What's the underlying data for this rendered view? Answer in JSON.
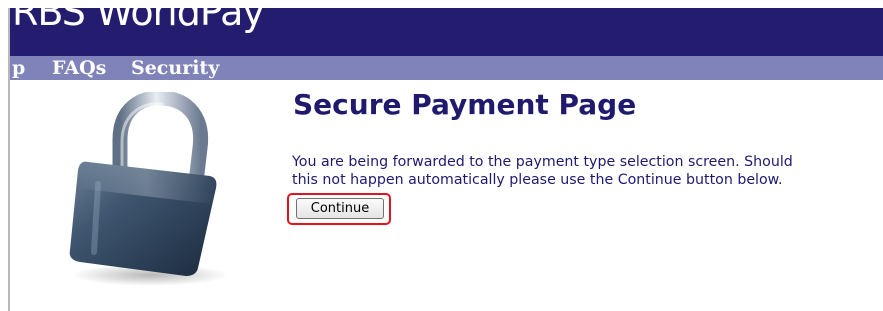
{
  "header": {
    "brand": "RBS WorldPay"
  },
  "nav": {
    "items": [
      {
        "label": "p"
      },
      {
        "label": "FAQs"
      },
      {
        "label": "Security"
      }
    ]
  },
  "main": {
    "title": "Secure Payment Page",
    "message_line1": "You are being forwarded to the payment type selection screen. Should",
    "message_line2": "this not happen automatically please use the Continue button below.",
    "continue_label": "Continue"
  },
  "colors": {
    "brand_bar": "#241c6e",
    "nav_bar": "#7f83b9",
    "title_text": "#1f1a6e",
    "highlight": "#e0141e"
  },
  "icons": {
    "lock_image": "padlock-icon"
  }
}
